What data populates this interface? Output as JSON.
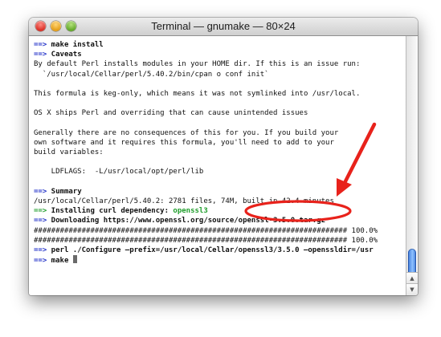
{
  "window": {
    "title": "Terminal — gnumake — 80×24"
  },
  "terminal": {
    "lines": [
      {
        "prefix": "==>",
        "prefix_color": "blue",
        "text": " make install",
        "bold": true
      },
      {
        "prefix": "==>",
        "prefix_color": "blue",
        "text": " Caveats",
        "bold": true
      },
      {
        "text": "By default Perl installs modules in your HOME dir. If this is an issue run:"
      },
      {
        "text": "  `/usr/local/Cellar/perl/5.40.2/bin/cpan o conf init`"
      },
      {
        "text": ""
      },
      {
        "text": "This formula is keg-only, which means it was not symlinked into /usr/local."
      },
      {
        "text": ""
      },
      {
        "text": "OS X ships Perl and overriding that can cause unintended issues"
      },
      {
        "text": ""
      },
      {
        "text": "Generally there are no consequences of this for you. If you build your"
      },
      {
        "text": "own software and it requires this formula, you'll need to add to your"
      },
      {
        "text": "build variables:"
      },
      {
        "text": ""
      },
      {
        "text": "    LDFLAGS:  -L/usr/local/opt/perl/lib"
      },
      {
        "text": ""
      },
      {
        "prefix": "==>",
        "prefix_color": "blue",
        "text": " Summary",
        "bold": true
      },
      {
        "text": "/usr/local/Cellar/perl/5.40.2: 2781 files, 74M, built in 42.4 minutes"
      },
      {
        "prefix": "==>",
        "prefix_color": "green",
        "text": " Installing curl dependency: ",
        "bold": true,
        "suffix": "openssl3",
        "suffix_color": "green"
      },
      {
        "prefix": "==>",
        "prefix_color": "blue",
        "text": " Downloading https://www.openssl.org/source/openssl-3.5.0.tar.gz",
        "bold": true
      },
      {
        "text": "######################################################################## 100.0%"
      },
      {
        "text": "######################################################################## 100.0%"
      },
      {
        "prefix": "==>",
        "prefix_color": "blue",
        "text": " perl ./Configure —prefix=/usr/local/Cellar/openssl3/3.5.0 —openssldir=/usr",
        "bold": true
      },
      {
        "prefix": "==>",
        "prefix_color": "blue",
        "text": " make",
        "bold": true
      }
    ],
    "cursor_visible": true
  },
  "colors": {
    "prompt_blue": "#2332c8",
    "prompt_green": "#1f9d2b",
    "annotation_red": "#e8221b"
  },
  "icons": {
    "close": "close-button",
    "minimize": "minimize-button",
    "zoom": "zoom-button",
    "scroll_up": "arrow-up-icon",
    "scroll_down": "arrow-down-icon"
  },
  "annotation": {
    "type": "red-arrow-and-ellipse",
    "highlighted_text": "built in 42.4 minutes"
  }
}
